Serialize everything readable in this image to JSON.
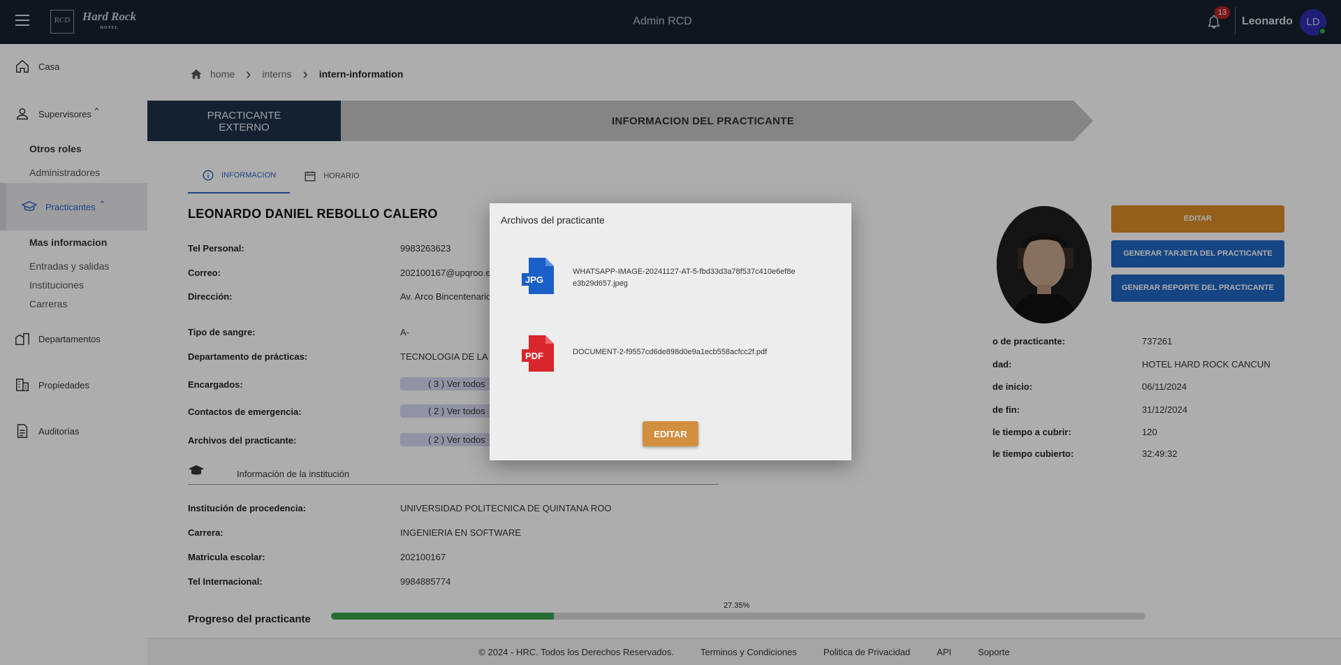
{
  "header": {
    "logo_rcd": "RCD",
    "logo_hardrock": "Hard Rock",
    "logo_hotel": "HOTEL",
    "title": "Admin RCD",
    "notification_count": "13",
    "user_name": "Leonardo",
    "user_initials": "LD"
  },
  "sidebar": {
    "casa": "Casa",
    "supervisores": "Supervisores",
    "otros_roles": "Otros roles",
    "administradores": "Administradores",
    "practicantes": "Practicantes",
    "mas_informacion": "Mas informacion",
    "entradas_salidas": "Entradas y salidas",
    "instituciones": "Instituciones",
    "carreras": "Carreras",
    "departamentos": "Departamentos",
    "propiedades": "Propiedades",
    "auditorias": "Auditorías"
  },
  "breadcrumb": {
    "home": "home",
    "interns": "interns",
    "current": "intern-information"
  },
  "stage": {
    "left_line1": "PRACTICANTE",
    "left_line2": "EXTERNO",
    "right": "INFORMACION DEL PRACTICANTE"
  },
  "tabs": {
    "info": "INFORMACION",
    "horario": "HORARIO"
  },
  "intern": {
    "name": "LEONARDO DANIEL REBOLLO CALERO",
    "fields": {
      "tel_personal": {
        "k": "Tel Personal:",
        "v": "9983263623"
      },
      "correo": {
        "k": "Correo:",
        "v": "202100167@upqroo.e"
      },
      "direccion": {
        "k": "Dirección:",
        "v": "Av. Arco Bincentenario"
      },
      "sangre": {
        "k": "Tipo de sangre:",
        "v": "A-"
      },
      "departamento": {
        "k": "Departamento de prácticas:",
        "v": "TECNOLOGIA DE LA IN"
      },
      "encargados": {
        "k": "Encargados:",
        "v": "( 3 ) Ver todos"
      },
      "contactos": {
        "k": "Contactos de emergencia:",
        "v": "( 2 ) Ver todos"
      },
      "archivos": {
        "k": "Archivos del practicante:",
        "v": "( 2 ) Ver todos"
      }
    },
    "institution_header": "Información de la institución",
    "institution": {
      "procedencia": {
        "k": "Institución de procedencia:",
        "v": "UNIVERSIDAD POLITECNICA DE QUINTANA ROO"
      },
      "carrera": {
        "k": "Carrera:",
        "v": "INGENIERIA EN SOFTWARE"
      },
      "matricula": {
        "k": "Matricula escolar:",
        "v": "202100167"
      },
      "tel_internacional": {
        "k": "Tel Internacional:",
        "v": "9984885774"
      }
    },
    "progress_label": "Progreso del practicante",
    "progress_value": 27.35,
    "progress_text": "27.35%"
  },
  "actions": {
    "editar": "EDITAR",
    "tarjeta": "GENERAR TARJETA DEL PRACTICANTE",
    "reporte": "GENERAR REPORTE DEL PRACTICANTE"
  },
  "details": {
    "codigo": {
      "k": "o de practicante:",
      "v": "737261"
    },
    "propiedad": {
      "k": "dad:",
      "v": "HOTEL HARD ROCK CANCUN"
    },
    "inicio": {
      "k": "de inicio:",
      "v": "06/11/2024"
    },
    "fin": {
      "k": "de fin:",
      "v": "31/12/2024"
    },
    "tiempo_cubrir": {
      "k": "le tiempo a cubrir:",
      "v": "120"
    },
    "tiempo_cubierto": {
      "k": "le tiempo cubierto:",
      "v": "32:49:32"
    }
  },
  "footer": {
    "copyright": "© 2024 - HRC. Todos los Derechos Reservados.",
    "terminos": "Terminos y Condiciones",
    "privacidad": "Politica de Privacidad",
    "api": "API",
    "soporte": "Soporte"
  },
  "modal": {
    "title": "Archivos del practicante",
    "files": [
      {
        "type": "JPG",
        "name": "WHATSAPP-IMAGE-20241127-AT-5-fbd33d3a78f537c410e6ef8ee3b29d657.jpeg",
        "color": "#1a5fc7"
      },
      {
        "type": "PDF",
        "name": "DOCUMENT-2-f9557cd6de898d0e9a1ecb558acfcc2f.pdf",
        "color": "#d8262b"
      }
    ],
    "button": "EDITAR"
  }
}
